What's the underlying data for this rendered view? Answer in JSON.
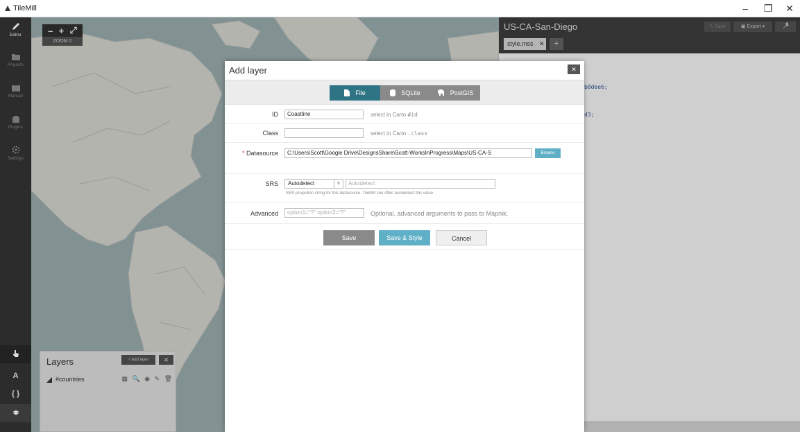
{
  "window": {
    "title": "TileMill",
    "minimize": "–",
    "maximize": "❐",
    "close": "✕"
  },
  "sidebar": {
    "items": [
      {
        "label": "Editor",
        "icon": "pencil-icon"
      },
      {
        "label": "Projects",
        "icon": "folder-icon"
      },
      {
        "label": "Manual",
        "icon": "book-icon"
      },
      {
        "label": "Plugins",
        "icon": "plugin-icon"
      },
      {
        "label": "Settings",
        "icon": "gear-icon"
      }
    ],
    "tools": [
      "A",
      "{ }"
    ]
  },
  "map": {
    "zoom_out": "–",
    "zoom_in": "+",
    "fullscreen": "⤢",
    "zoom_label": "ZOOM 2",
    "colors": {
      "water": "#9fb1b3",
      "land": "#dcdcd6"
    }
  },
  "layers_panel": {
    "title": "Layers",
    "add_label": "+ Add layer",
    "close": "✕",
    "rows": [
      {
        "name": "#countries",
        "tools": "▦ 🔍 ◉ ✎ 🗑"
      }
    ]
  },
  "editor": {
    "project_title": "US-CA-San-Diego",
    "save_label": "Save",
    "export_label": "Export",
    "tab": "style.mss",
    "tab_close": "✕",
    "tab_add": "+",
    "code_fragments": [
      "b8dee6;",
      "d3;"
    ]
  },
  "dialog": {
    "title": "Add layer",
    "close": "✕",
    "tabs": {
      "file": "File",
      "sqlite": "SQLite",
      "postgis": "PostGIS"
    },
    "id": {
      "label": "ID",
      "value": "Coastline",
      "hint_prefix": "select in Carto",
      "hint_code": "#id"
    },
    "class": {
      "label": "Class",
      "value": "",
      "hint_prefix": "select in Carto",
      "hint_code": ".class"
    },
    "datasource": {
      "required_mark": "*",
      "label": "Datasource",
      "value": "C:\\Users\\Scott\\Google Drive\\DesignsShare\\Scott-WorksInProgress\\Maps\\US-CA-S",
      "browse": "Browse"
    },
    "srs": {
      "label": "SRS",
      "selected": "Autodetect",
      "placeholder": "Autodetect",
      "help": "SRS projection string for this datasource. TileMill can often autodetect this value."
    },
    "advanced": {
      "label": "Advanced",
      "placeholder": "option1=\"?\" option2=\"?\"",
      "hint": "Optional, advanced arguments to pass to Mapnik."
    },
    "buttons": {
      "save": "Save",
      "save_style": "Save & Style",
      "cancel": "Cancel"
    },
    "accent_color": "#2f7484"
  }
}
